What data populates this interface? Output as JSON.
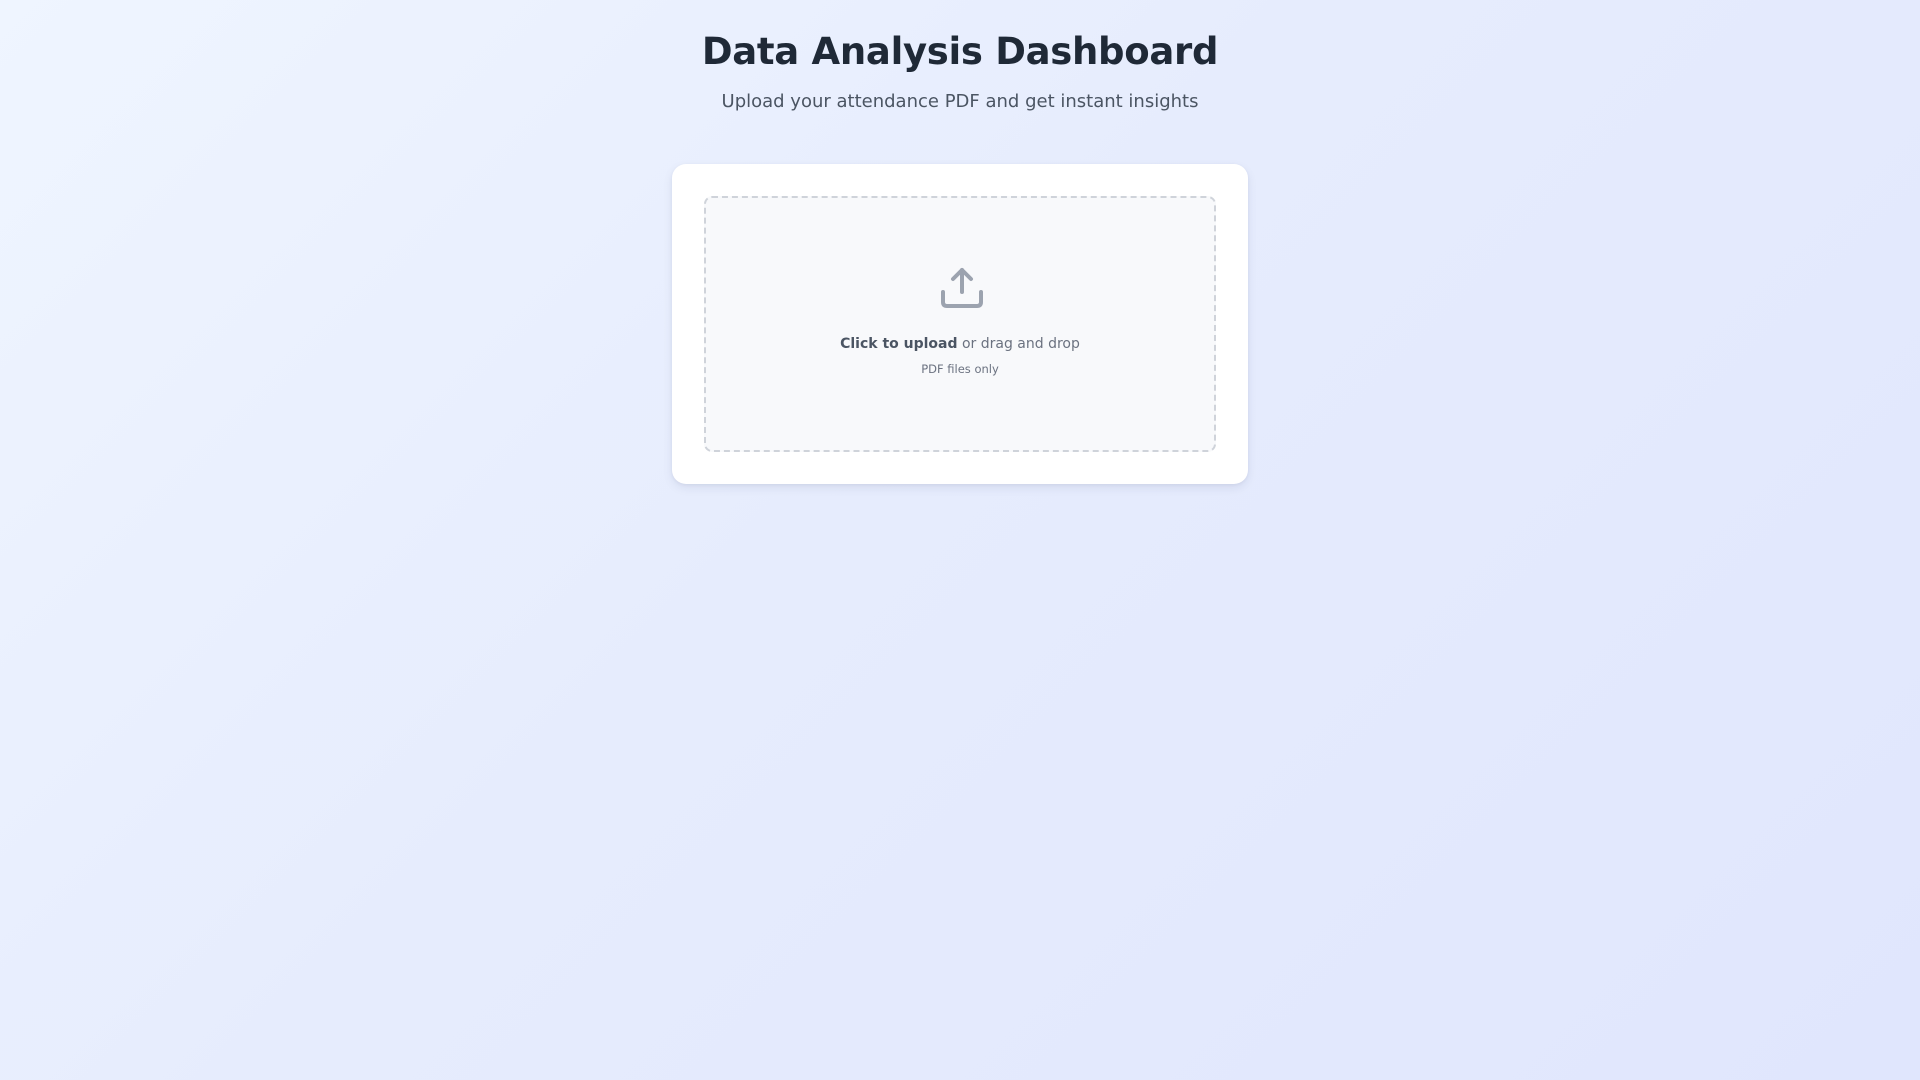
{
  "header": {
    "title": "Data Analysis Dashboard",
    "subtitle": "Upload your attendance PDF and get instant insights"
  },
  "upload": {
    "icon": "upload-icon",
    "click_label": "Click to upload",
    "drag_label": " or drag and drop",
    "hint": "PDF files only"
  },
  "colors": {
    "title": "#1f2937",
    "subtitle": "#4b5563",
    "icon": "#9ca3af",
    "dropzone_border": "#cfd3da",
    "card_background": "#ffffff"
  }
}
